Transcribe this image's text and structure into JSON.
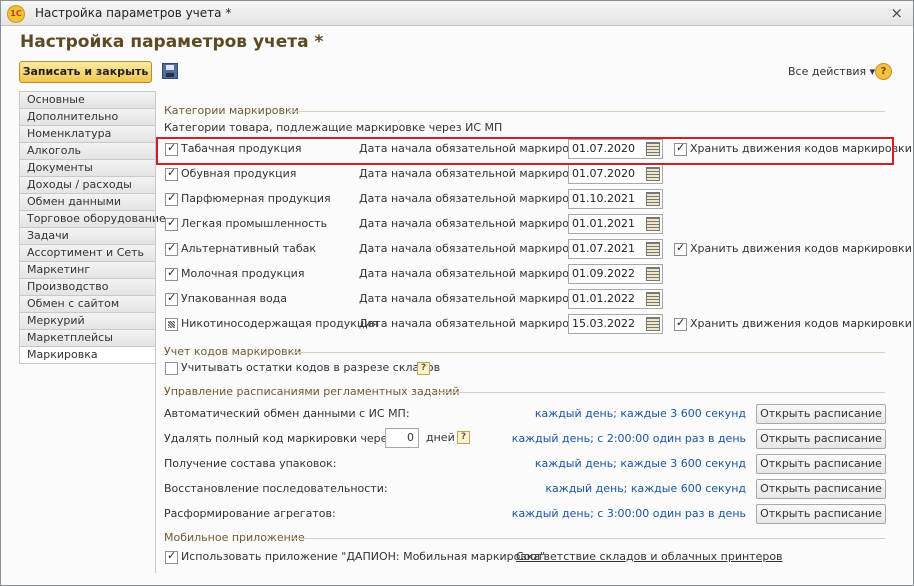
{
  "window": {
    "title": "Настройка параметров учета *",
    "close": "×",
    "app_icon": "1С"
  },
  "form": {
    "title": "Настройка параметров учета *"
  },
  "toolbar": {
    "save_close": "Записать и закрыть",
    "all_actions": "Все действия ▾",
    "help": "?"
  },
  "sidebar": {
    "items": [
      "Основные",
      "Дополнительно",
      "Номенклатура",
      "Алкоголь",
      "Документы",
      "Доходы / расходы",
      "Обмен данными",
      "Торговое оборудование",
      "Задачи",
      "Ассортимент и Сеть",
      "Маркетинг",
      "Производство",
      "Обмен с сайтом",
      "Меркурий",
      "Маркетплейсы",
      "Маркировка"
    ],
    "active": "Маркировка"
  },
  "categories": {
    "group_title": "Категории маркировки",
    "link": "Категории товара, подлежащие маркировке через ИС МП",
    "date_label": "Дата начала обязательной маркировки:",
    "store_label": "Хранить движения кодов маркировки",
    "rows": [
      {
        "name": "Табачная продукция",
        "checked": true,
        "date": "01.07.2020",
        "store": true
      },
      {
        "name": "Обувная продукция",
        "checked": true,
        "date": "01.07.2020",
        "store": null
      },
      {
        "name": "Парфюмерная продукция",
        "checked": true,
        "date": "01.10.2021",
        "store": null
      },
      {
        "name": "Легкая промышленность",
        "checked": true,
        "date": "01.01.2021",
        "store": null
      },
      {
        "name": "Альтернативный табак",
        "checked": true,
        "date": "01.07.2021",
        "store": true
      },
      {
        "name": "Молочная продукция",
        "checked": true,
        "date": "01.09.2022",
        "store": null
      },
      {
        "name": "Упакованная вода",
        "checked": true,
        "date": "01.01.2022",
        "store": null
      },
      {
        "name": "Никотиносодержащая продукция",
        "checked": "indeterminate",
        "date": "15.03.2022",
        "store": true
      }
    ]
  },
  "codes": {
    "group_title": "Учет кодов маркировки",
    "checkbox": "Учитывать остатки кодов в разрезе складов",
    "help": "?"
  },
  "schedules": {
    "group_title": "Управление расписаниями регламентных заданий",
    "button": "Открыть расписание",
    "days_unit": "дней",
    "days_value": "0",
    "rows": [
      {
        "label": "Автоматический обмен данными с ИС МП:",
        "schedule": "каждый день; каждые 3 600 секунд"
      },
      {
        "label": "Удалять полный код маркировки через:",
        "schedule": "каждый день; с 2:00:00 один раз в день"
      },
      {
        "label": "Получение состава упаковок:",
        "schedule": "каждый день; каждые 3 600 секунд"
      },
      {
        "label": "Восстановление последовательности:",
        "schedule": "каждый день; каждые 600 секунд"
      },
      {
        "label": "Расформирование агрегатов:",
        "schedule": "каждый день; с 3:00:00 один раз в день"
      }
    ]
  },
  "mobile": {
    "group_title": "Мобильное приложение",
    "checkbox": "Использовать приложение \"ДАПИОН: Мобильная маркировка\"",
    "link": "Соответствие складов и облачных принтеров"
  }
}
